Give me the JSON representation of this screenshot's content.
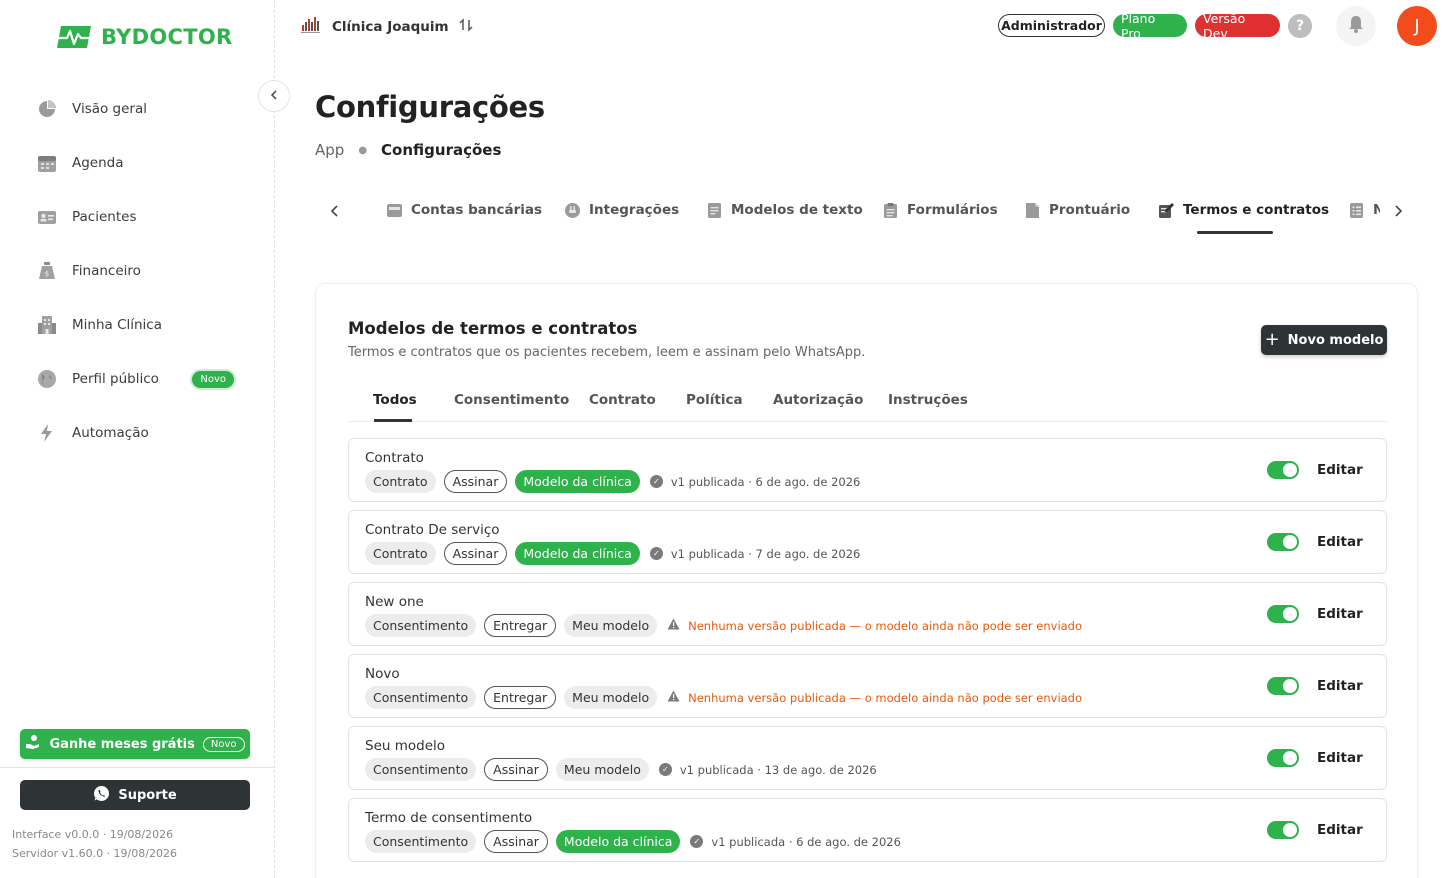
{
  "brand": {
    "name": "BYDOCTOR",
    "color": "#2fb24c"
  },
  "sidebar": {
    "items": [
      {
        "label": "Visão geral",
        "icon": "pie-chart-icon"
      },
      {
        "label": "Agenda",
        "icon": "calendar-icon"
      },
      {
        "label": "Pacientes",
        "icon": "id-card-icon"
      },
      {
        "label": "Financeiro",
        "icon": "money-bag-icon"
      },
      {
        "label": "Minha Clínica",
        "icon": "building-icon"
      },
      {
        "label": "Perfil público",
        "icon": "globe-icon",
        "badge": "Novo"
      },
      {
        "label": "Automação",
        "icon": "lightning-icon"
      }
    ],
    "promo": {
      "label": "Ganhe meses grátis",
      "badge": "Novo"
    },
    "support": {
      "label": "Suporte"
    },
    "interface_version": "Interface v0.0.0 · 19/08/2026",
    "server_version": "Servidor v1.60.0 · 19/08/2026"
  },
  "topbar": {
    "clinic_name": "Clínica Joaquim",
    "pills": {
      "admin": "Administrador",
      "plan": "Plano Pro",
      "version": "Versão Dev"
    },
    "help": "?",
    "avatar_initial": "J"
  },
  "page": {
    "title": "Configurações",
    "breadcrumb": {
      "root": "App",
      "current": "Configurações"
    }
  },
  "settings_tabs": [
    {
      "label": "Contas bancárias",
      "icon": "bank-icon"
    },
    {
      "label": "Integrações",
      "icon": "plug-icon"
    },
    {
      "label": "Modelos de texto",
      "icon": "document-icon"
    },
    {
      "label": "Formulários",
      "icon": "clipboard-icon"
    },
    {
      "label": "Prontuário",
      "icon": "file-icon"
    },
    {
      "label": "Termos e contratos",
      "icon": "signature-icon",
      "active": true
    },
    {
      "label": "N",
      "icon": "list-icon"
    }
  ],
  "card": {
    "title": "Modelos de termos e contratos",
    "subtitle": "Termos e contratos que os pacientes recebem, leem e assinam pelo WhatsApp.",
    "new_button": "Novo modelo",
    "filters": [
      "Todos",
      "Consentimento",
      "Contrato",
      "Política",
      "Autorização",
      "Instruções"
    ],
    "rows": [
      {
        "name": "Contrato",
        "type": "Contrato",
        "action": "Assinar",
        "origin": "Modelo da clínica",
        "origin_style": "green",
        "status": "v1 publicada · 6 de ago. de 2026",
        "warn": false,
        "edit": "Editar"
      },
      {
        "name": "Contrato De serviço",
        "type": "Contrato",
        "action": "Assinar",
        "origin": "Modelo da clínica",
        "origin_style": "green",
        "status": "v1 publicada · 7 de ago. de 2026",
        "warn": false,
        "edit": "Editar"
      },
      {
        "name": "New one",
        "type": "Consentimento",
        "action": "Entregar",
        "origin": "Meu modelo",
        "origin_style": "gray",
        "status": "Nenhuma versão publicada — o modelo ainda não pode ser enviado",
        "warn": true,
        "edit": "Editar"
      },
      {
        "name": "Novo",
        "type": "Consentimento",
        "action": "Entregar",
        "origin": "Meu modelo",
        "origin_style": "gray",
        "status": "Nenhuma versão publicada — o modelo ainda não pode ser enviado",
        "warn": true,
        "edit": "Editar"
      },
      {
        "name": "Seu modelo",
        "type": "Consentimento",
        "action": "Assinar",
        "origin": "Meu modelo",
        "origin_style": "gray",
        "status": "v1 publicada · 13 de ago. de 2026",
        "warn": false,
        "edit": "Editar"
      },
      {
        "name": "Termo de consentimento",
        "type": "Consentimento",
        "action": "Assinar",
        "origin": "Modelo da clínica",
        "origin_style": "green",
        "status": "v1 publicada · 6 de ago. de 2026",
        "warn": false,
        "edit": "Editar"
      }
    ]
  },
  "colors": {
    "accent": "#2fb24c",
    "danger": "#e03131",
    "dark": "#2e3436",
    "avatar": "#f24c1d",
    "warning": "#e8590c"
  }
}
